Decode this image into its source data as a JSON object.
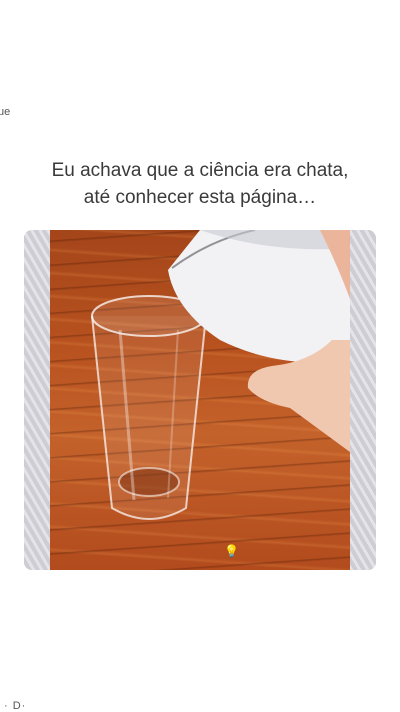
{
  "edge_text": {
    "top": "ue",
    "bottom": "· D·"
  },
  "caption": {
    "line1": "Eu achava que a ciência era chata,",
    "line2": "até conhecer esta página…"
  },
  "media": {
    "glass_icon": "glass-icon",
    "pitcher_icon": "pitcher-icon",
    "hand_icon": "hand-icon",
    "indicator_icon": "light-bulb-icon",
    "colors": {
      "wood": "#b8521f",
      "frame": "#d6d5dc",
      "milk": "#f2f2f4"
    }
  }
}
